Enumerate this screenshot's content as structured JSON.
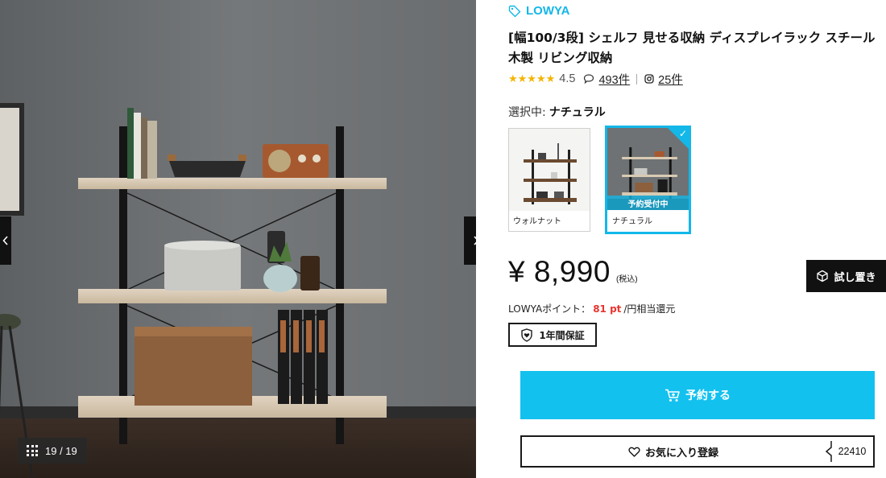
{
  "gallery": {
    "counter": "19 / 19",
    "prev_icon": "chevron-left-icon",
    "next_icon": "chevron-right-icon",
    "grid_icon": "grid-icon"
  },
  "product": {
    "brand": "LOWYA",
    "title": "[幅100/3段] シェルフ 見せる収納 ディスプレイラック スチール 木製 リビング収納",
    "rating_stars": "★★★★★",
    "rating": "4.5",
    "review_count": "493件",
    "instagram_count": "25件"
  },
  "variants": {
    "selected_label": "選択中:",
    "selected_value": "ナチュラル",
    "items": [
      {
        "label": "ウォルナット"
      },
      {
        "label": "ナチュラル",
        "badge": "予約受付中"
      }
    ]
  },
  "price": {
    "amount": "¥ 8,990",
    "tax_note": "(税込)"
  },
  "try_button": "試し置き",
  "points": {
    "label": "LOWYAポイント：",
    "value": "81 pt",
    "suffix": "/円相当還元"
  },
  "warranty": "1年間保証",
  "reserve_button": "予約する",
  "favorite": {
    "label": "お気に入り登録",
    "count": "22410"
  },
  "colors": {
    "accent": "#13b7e8",
    "button": "#13c1ef",
    "points": "#e8352f",
    "stars": "#f4b400"
  }
}
